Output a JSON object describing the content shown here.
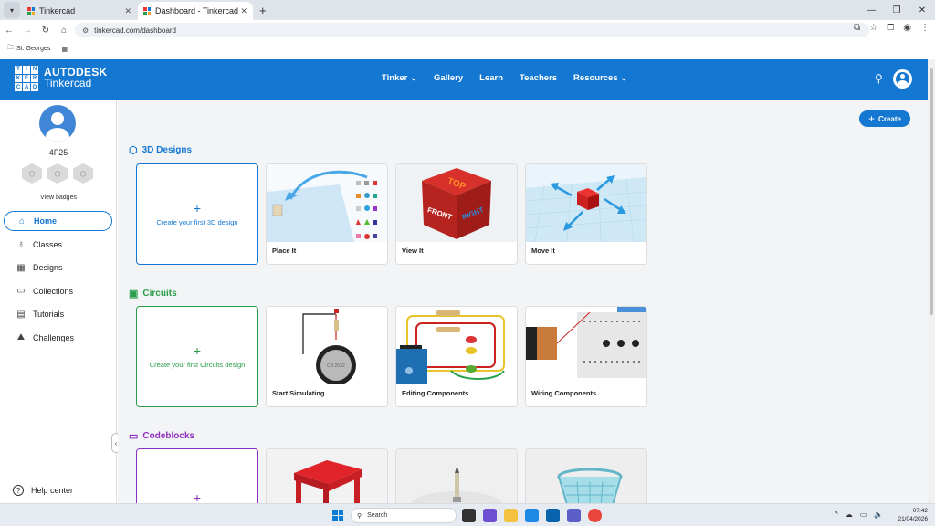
{
  "browser": {
    "tabs": [
      {
        "title": "Tinkercad",
        "active": false
      },
      {
        "title": "Dashboard - Tinkercad",
        "active": true
      }
    ],
    "url": "tinkercad.com/dashboard",
    "bookmarks": [
      {
        "label": "St. Georges"
      }
    ]
  },
  "header": {
    "logo_letters": [
      "TIN",
      "KER",
      "CAD"
    ],
    "brand_line1": "AUTODESK",
    "brand_line2": "Tinkercad",
    "nav": [
      {
        "label": "Tinker ⌄"
      },
      {
        "label": "Gallery"
      },
      {
        "label": "Learn"
      },
      {
        "label": "Teachers"
      },
      {
        "label": "Resources ⌄"
      }
    ]
  },
  "sidebar": {
    "username": "4F25",
    "view_badges": "View badges",
    "items": [
      {
        "label": "Home",
        "icon": "home-icon",
        "active": true
      },
      {
        "label": "Classes",
        "icon": "apple-icon"
      },
      {
        "label": "Designs",
        "icon": "grid-icon"
      },
      {
        "label": "Collections",
        "icon": "collection-icon"
      },
      {
        "label": "Tutorials",
        "icon": "book-icon"
      },
      {
        "label": "Challenges",
        "icon": "mountain-icon"
      }
    ],
    "help": "Help center"
  },
  "main": {
    "create_label": "Create",
    "sections": [
      {
        "title": "3D Designs",
        "color": "#1477d1",
        "create_text": "Create your first 3D design",
        "cards": [
          "Place It",
          "View It",
          "Move It"
        ]
      },
      {
        "title": "Circuits",
        "color": "#2a9d4b",
        "create_text": "Create your first Circuits design",
        "cards": [
          "Start Simulating",
          "Editing Components",
          "Wiring Components"
        ]
      },
      {
        "title": "Codeblocks",
        "color": "#8e2fc2",
        "create_text": "",
        "cards": [
          "",
          "",
          ""
        ]
      }
    ]
  },
  "taskbar": {
    "search_placeholder": "Search",
    "time": "07:42",
    "date": "21/04/2026"
  },
  "colors": {
    "brand_blue": "#1477d1",
    "circuits_green": "#2a9d4b",
    "codeblocks_purple": "#8e2fc2"
  }
}
